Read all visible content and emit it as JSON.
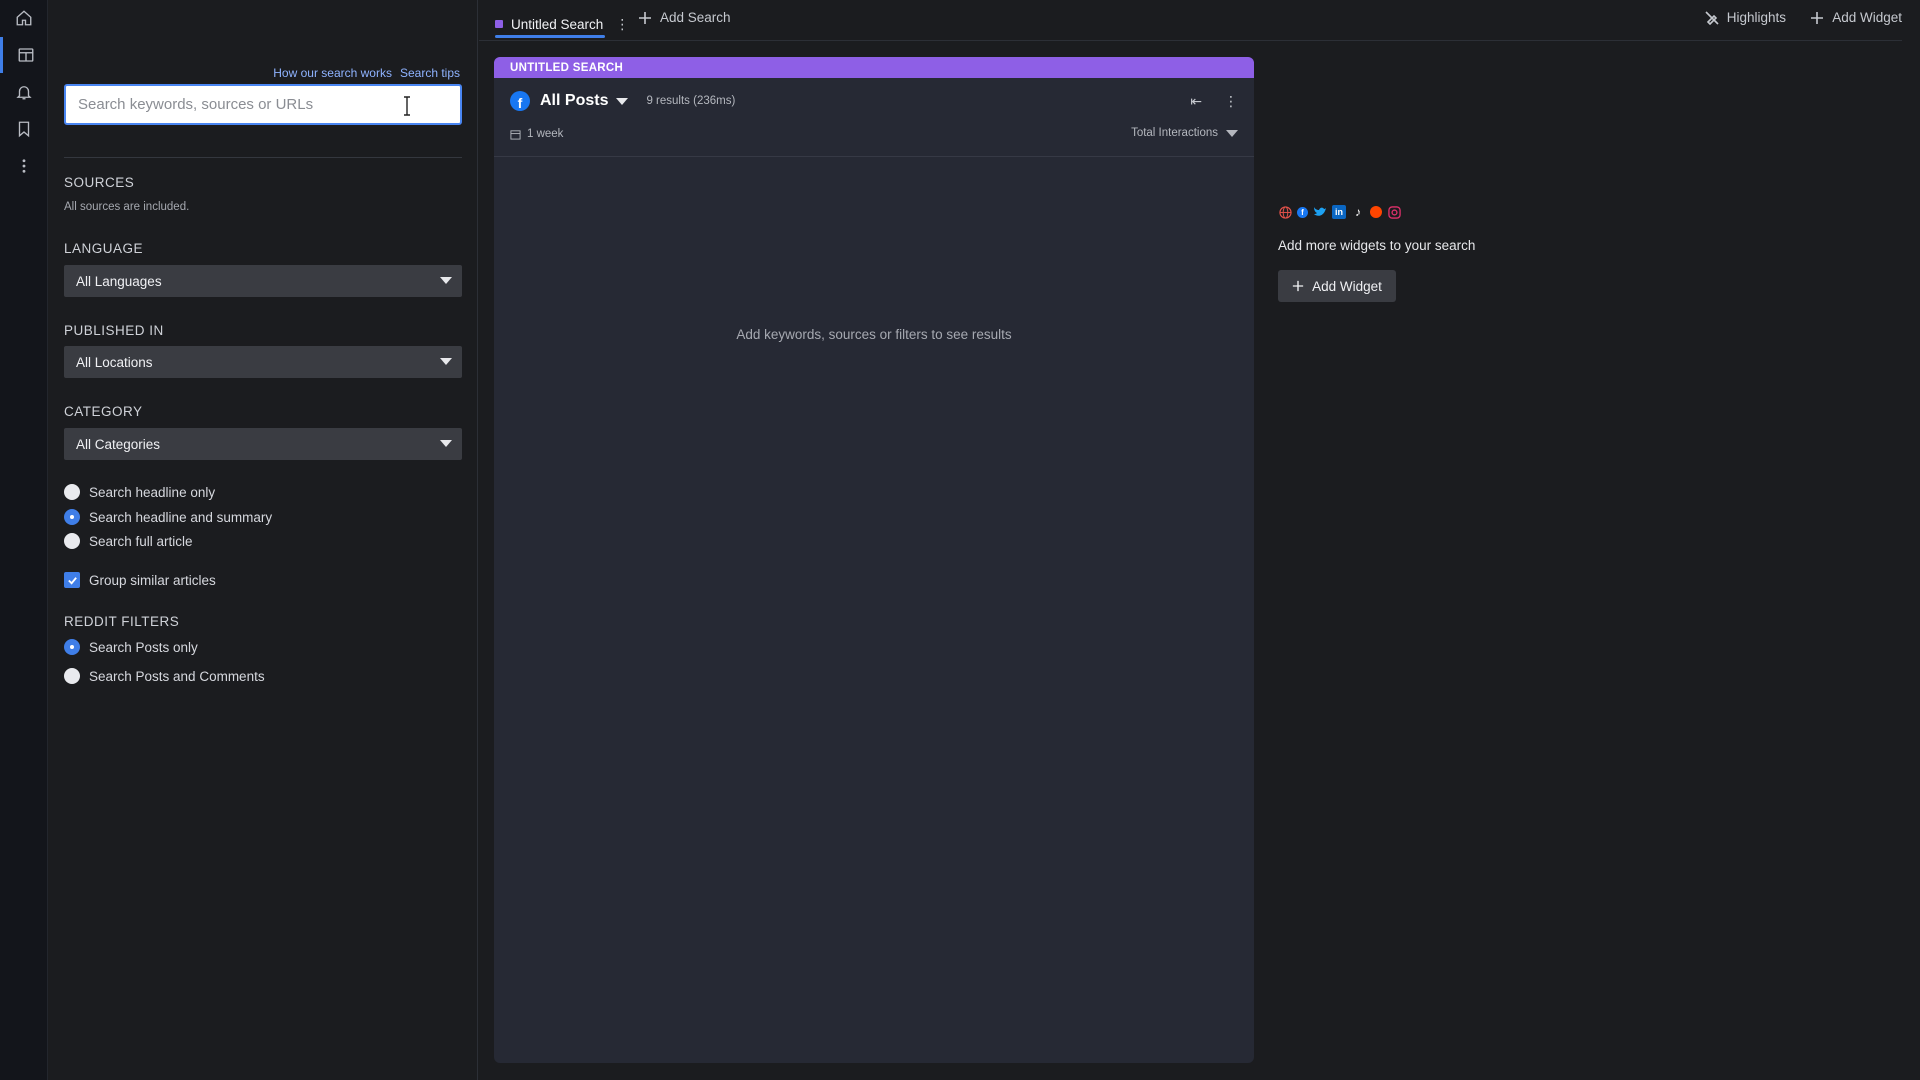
{
  "sidebar_links": {
    "how_search_works": "How our search works",
    "search_tips": "Search tips"
  },
  "search": {
    "placeholder": "Search keywords, sources or URLs",
    "value": ""
  },
  "sources": {
    "title": "SOURCES",
    "subtitle": "All sources are included."
  },
  "language": {
    "title": "LANGUAGE",
    "selected": "All Languages"
  },
  "published_in": {
    "title": "PUBLISHED IN",
    "selected": "All Locations"
  },
  "category": {
    "title": "CATEGORY",
    "selected": "All Categories"
  },
  "search_scope": [
    {
      "label": "Search headline only",
      "checked": false
    },
    {
      "label": "Search headline and summary",
      "checked": true
    },
    {
      "label": "Search full article",
      "checked": false
    }
  ],
  "group_similar": {
    "label": "Group similar articles",
    "checked": true
  },
  "reddit": {
    "title": "REDDIT FILTERS",
    "options": [
      {
        "label": "Search Posts only",
        "checked": true
      },
      {
        "label": "Search Posts and Comments",
        "checked": false
      }
    ]
  },
  "topbar": {
    "active_tab": "Untitled Search",
    "add_search": "Add Search",
    "highlights": "Highlights",
    "add_widget": "Add Widget"
  },
  "widget": {
    "header": "UNTITLED SEARCH",
    "title": "All Posts",
    "results": "9 results (236ms)",
    "period": "1 week",
    "sort": "Total Interactions",
    "empty_message": "Add keywords, sources or filters to see results"
  },
  "add_area": {
    "text": "Add more widgets to your search",
    "button": "Add Widget"
  },
  "colors": {
    "accent_blue": "#3f7ee8",
    "accent_purple": "#8e5fe6",
    "panel": "#262934",
    "background": "#1b1c1f"
  },
  "icons": [
    "home-icon",
    "dashboard-icon",
    "bell-icon",
    "bookmark-icon",
    "more-vertical-icon",
    "calendar-icon",
    "facebook-icon",
    "collapse-icon",
    "plus-icon",
    "highlight-off-icon"
  ]
}
